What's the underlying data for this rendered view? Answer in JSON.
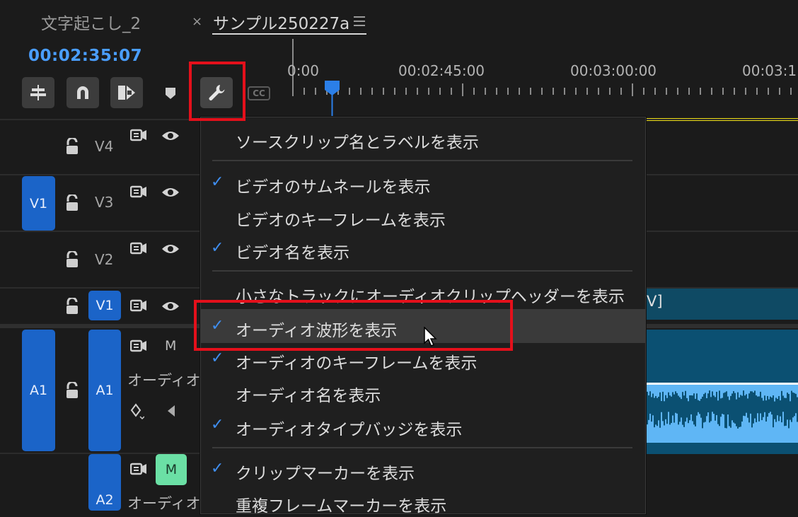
{
  "tabs": [
    {
      "label": "文字起こし_2",
      "active": false
    },
    {
      "label": "サンプル250227a",
      "active": true,
      "close": "×",
      "menu_icon": "hamburger-icon"
    }
  ],
  "timecode": "00:02:35:07",
  "ruler": {
    "times": [
      "0:00",
      "00:02:45:00",
      "00:03:00:00",
      "00:03:1"
    ]
  },
  "toolbar": {
    "cc_label": "CC"
  },
  "tracks": {
    "v4": "V4",
    "v3": "V3",
    "v2": "V2",
    "v1": "V1",
    "a1": "A1",
    "a1_target": "A1",
    "v1_target": "V1",
    "a1_mute": "M",
    "a1_name": "オーディオ",
    "a2_mute": "M",
    "a2_partial": "A2",
    "a2_name_partial": "オーディオ"
  },
  "clips": {
    "video_clip_fragment": "V]"
  },
  "menu": {
    "items": [
      {
        "label": "ソースクリップ名とラベルを表示",
        "checked": false
      },
      {
        "label": "ビデオのサムネールを表示",
        "checked": true
      },
      {
        "label": "ビデオのキーフレームを表示",
        "checked": false
      },
      {
        "label": "ビデオ名を表示",
        "checked": true
      },
      {
        "label": "小さなトラックにオーディオクリップヘッダーを表示",
        "checked": false
      },
      {
        "label": "オーディオ波形を表示",
        "checked": true,
        "hovered": true
      },
      {
        "label": "オーディオのキーフレームを表示",
        "checked": true
      },
      {
        "label": "オーディオ名を表示",
        "checked": false
      },
      {
        "label": "オーディオタイプバッジを表示",
        "checked": true
      },
      {
        "label": "クリップマーカーを表示",
        "checked": true
      },
      {
        "label": "重複フレームマーカーを表示",
        "checked": false
      }
    ],
    "check_glyph": "✓"
  },
  "colors": {
    "accent": "#4a9eff",
    "highlight_box": "#e4101b",
    "track_blue": "#1b64c8",
    "mute_green": "#6be0a5"
  }
}
